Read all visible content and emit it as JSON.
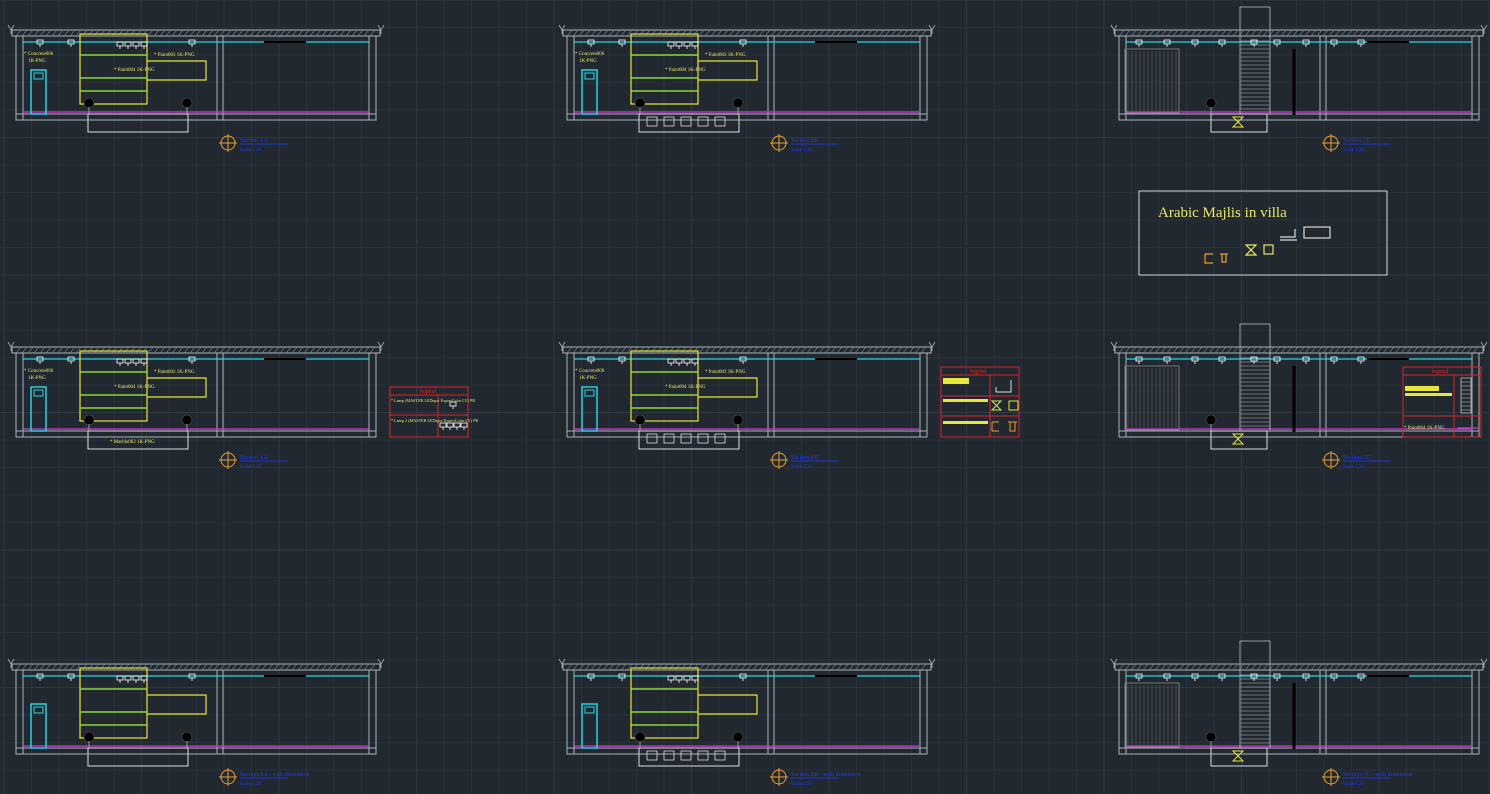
{
  "drawing": {
    "background": "#212830",
    "grid_minor_color": "#28313a",
    "grid_major_color": "#2e3944",
    "colors": {
      "wall": "#a9b4b8",
      "ceiling_line": "#29d3e0",
      "floor_finish": "#d238d8",
      "panel_yellow": "#e6e63c",
      "panel_green": "#8fd63a",
      "door": "#29d3e0",
      "legend_red": "#d2262a",
      "label_blue": "#1e3cff",
      "note_yellow": "#e8e86a",
      "title_text": "#e8e86a",
      "symbol_orange": "#e8a030"
    }
  },
  "title_box": {
    "title": "Arabic Majlis in villa"
  },
  "sections": [
    {
      "id": "s1",
      "tag_line1": "Section AA",
      "tag_line2": "Scale 1:20",
      "variant": "A",
      "notes": [
        "* Concrete006",
        "1K-PNG",
        "* Paint003  1K-PNG",
        "* Paint004  1K-PNG"
      ],
      "bottom_note": ""
    },
    {
      "id": "s2",
      "tag_line1": "Section BB",
      "tag_line2": "Scale 1:20",
      "variant": "B",
      "notes": [
        "* Concrete006",
        "1K-PNG",
        "* Paint003  1K-PNG",
        "* Paint004  1K-PNG"
      ],
      "bottom_note": ""
    },
    {
      "id": "s3",
      "tag_line1": "Section CC",
      "tag_line2": "Scale 1:20",
      "variant": "C",
      "notes": [],
      "bottom_note": ""
    },
    {
      "id": "s4",
      "tag_line1": "Section AA",
      "tag_line2": "Scale 1:20",
      "variant": "A",
      "notes": [
        "* Concrete006",
        "1K-PNG",
        "* Paint003  1K-PNG",
        "* Paint004  1K-PNG"
      ],
      "bottom_note": "* Marble002  1K-PNG"
    },
    {
      "id": "s5",
      "tag_line1": "Section BB",
      "tag_line2": "Scale 1:20",
      "variant": "B",
      "notes": [
        "* Concrete006",
        "1K-PNG",
        "* Paint003  1K-PNG",
        "* Paint004  1K-PNG"
      ],
      "bottom_note": ""
    },
    {
      "id": "s6",
      "tag_line1": "Section CC",
      "tag_line2": "Scale 1:20",
      "variant": "C",
      "notes": [],
      "bottom_note": ""
    },
    {
      "id": "s7",
      "tag_line1": "Section AA - with dimension",
      "tag_line2": "Scale 1:20",
      "variant": "A",
      "notes": [],
      "bottom_note": ""
    },
    {
      "id": "s8",
      "tag_line1": "Section BB - with dimension",
      "tag_line2": "Scale 1:20",
      "variant": "B",
      "notes": [],
      "bottom_note": ""
    },
    {
      "id": "s9",
      "tag_line1": "Section CC - with dimension",
      "tag_line2": "Scale 1:20",
      "variant": "C",
      "notes": [],
      "bottom_note": ""
    }
  ],
  "legends": [
    {
      "id": "legend-a",
      "title": "legend",
      "rows": [
        "* Lamp (MASTER LEDspot ExpertColor LV) PR",
        "* Lamp 2 (MASTER LEDspot ExpertColor LV) PR"
      ]
    },
    {
      "id": "legend-b",
      "title": "legend",
      "rows": []
    },
    {
      "id": "legend-c",
      "title": "legend",
      "rows": [
        "* Paint004  1K-PNG"
      ]
    }
  ]
}
